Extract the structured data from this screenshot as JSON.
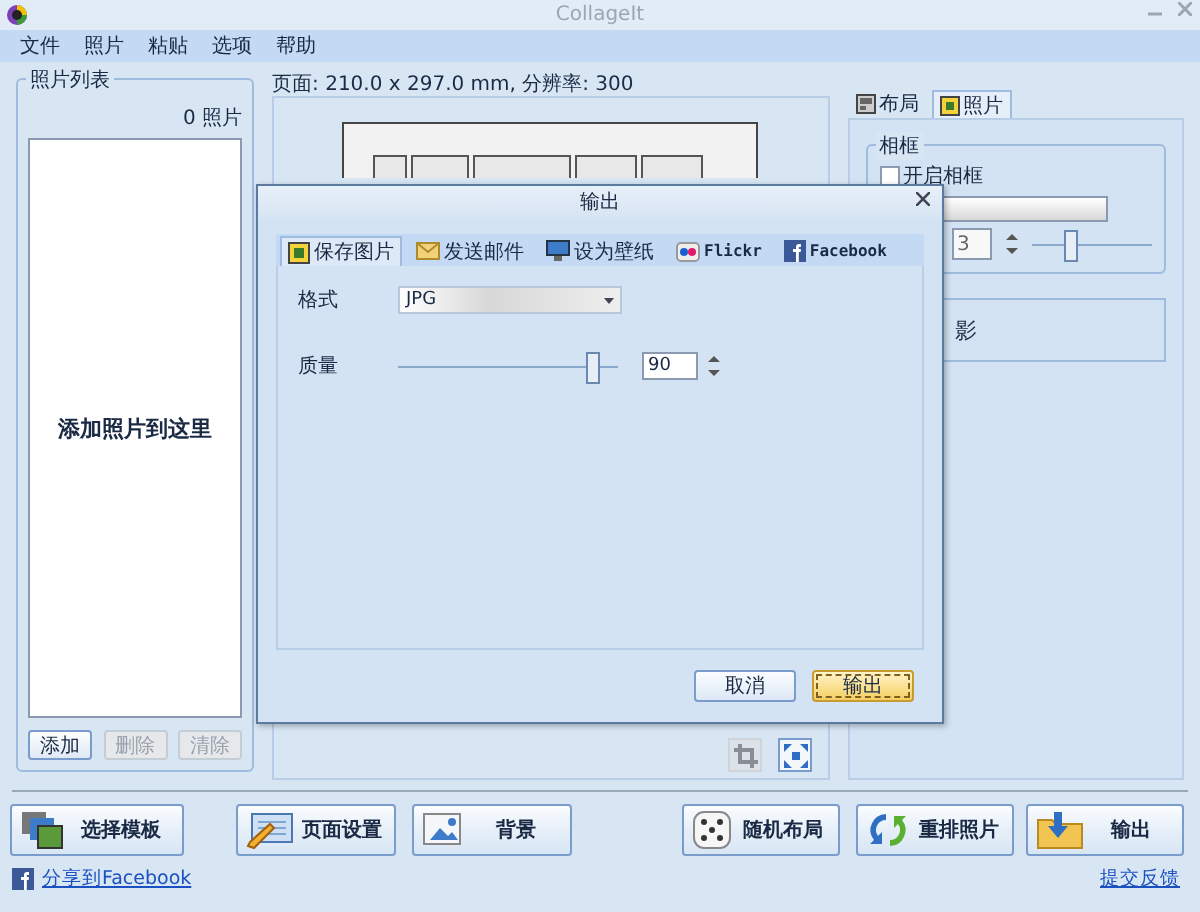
{
  "window": {
    "title": "CollageIt"
  },
  "menu": [
    "文件",
    "照片",
    "粘贴",
    "选项",
    "帮助"
  ],
  "photo_list": {
    "title": "照片列表",
    "count": "0 照片",
    "hint": "添加照片到这里",
    "buttons": [
      {
        "label": "添加",
        "disabled": false
      },
      {
        "label": "删除",
        "disabled": true
      },
      {
        "label": "清除",
        "disabled": true
      }
    ]
  },
  "page_info": "页面: 210.0 x 297.0 mm, 分辨率: 300",
  "canvas_tools": [
    {
      "kind": "crop",
      "disabled": true
    },
    {
      "kind": "fit",
      "disabled": false
    }
  ],
  "side_panel": {
    "tabs": [
      {
        "label": "布局",
        "selected": false
      },
      {
        "label": "照片",
        "selected": true
      }
    ],
    "frame_group": {
      "title": "相框",
      "checkbox": {
        "label": "开启相框",
        "checked": false
      },
      "spin_value": "3",
      "level": 0.33
    },
    "shadow_group": {
      "label": "影"
    }
  },
  "bottom_buttons": [
    {
      "label": "选择模板",
      "kind": "template"
    },
    {
      "label": "页面设置",
      "kind": "page"
    },
    {
      "label": "背景",
      "kind": "background"
    },
    {
      "label": "随机布局",
      "kind": "random"
    },
    {
      "label": "重排照片",
      "kind": "shuffle"
    },
    {
      "label": "输出",
      "kind": "export"
    }
  ],
  "links": [
    "分享到Facebook",
    "提交反馈"
  ],
  "dialog": {
    "title": "输出",
    "tabs": [
      {
        "label": "保存图片",
        "kind": "save",
        "selected": true
      },
      {
        "label": "发送邮件",
        "kind": "mail",
        "selected": false
      },
      {
        "label": "设为壁纸",
        "kind": "wallpaper",
        "selected": false
      },
      {
        "label": "Flickr",
        "kind": "flickr",
        "selected": false
      },
      {
        "label": "Facebook",
        "kind": "facebook",
        "selected": false
      }
    ],
    "format": {
      "label": "格式",
      "value": "JPG"
    },
    "quality": {
      "label": "质量",
      "level": 0.88,
      "value": "90"
    },
    "buttons": [
      {
        "label": "取消",
        "default": false
      },
      {
        "label": "输出",
        "default": true
      }
    ]
  }
}
